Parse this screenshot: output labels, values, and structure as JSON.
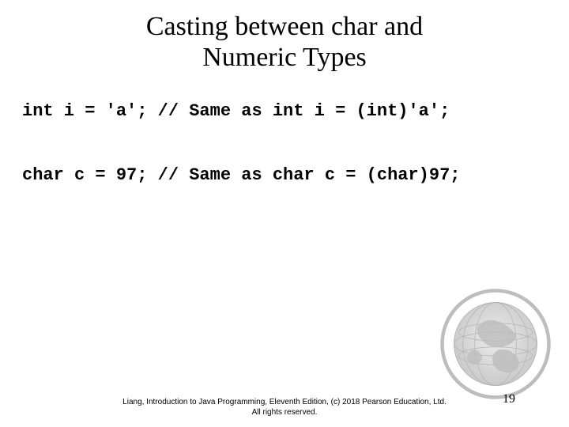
{
  "title_line1": "Casting between char and",
  "title_line2": "Numeric Types",
  "code_line1": "int i = 'a'; // Same as int i = (int)'a';",
  "code_line2": "char c = 97; // Same as char c = (char)97;",
  "footer_line1": "Liang, Introduction to Java Programming, Eleventh Edition, (c) 2018 Pearson Education, Ltd.",
  "footer_line2": "All rights reserved.",
  "page_number": "19"
}
